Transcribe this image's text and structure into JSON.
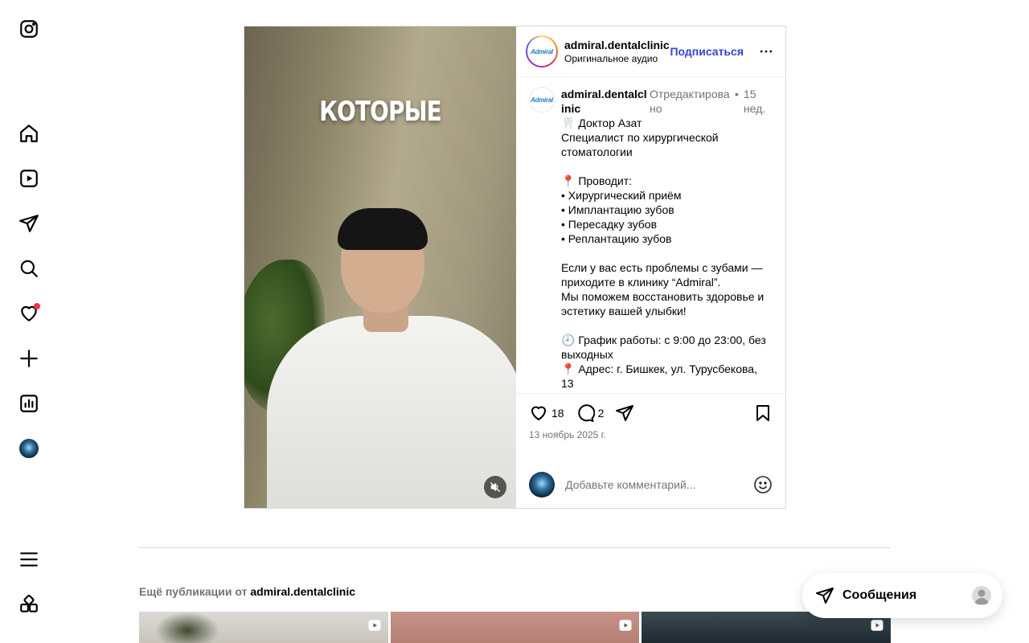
{
  "nav": {
    "items": [
      "instagram-logo",
      "home",
      "reels",
      "direct",
      "search",
      "notifications",
      "create",
      "insights",
      "profile",
      "more",
      "also-from-meta"
    ]
  },
  "post": {
    "media": {
      "overlay_text": "КОТОРЫЕ"
    },
    "header": {
      "username": "admiral.dentalclinic",
      "audio": "Оригинальное аудио",
      "follow_label": "Подписаться",
      "logo_text": "Admiral"
    },
    "caption": {
      "username": "admiral.dentalclinic",
      "edited": "Отредактировано",
      "dot": "•",
      "time": "15 нед.",
      "text": "🦷 Доктор Азат\nСпециалист по хирургической стоматологии\n\n📍 Проводит:\n• Хирургический приём\n• Имплантацию зубов\n• Пересадку зубов\n• Реплантацию зубов\n\nЕсли у вас есть проблемы с зубами — приходите в клинику “Admiral”.\nМы поможем восстановить здоровье и эстетику вашей улыбки!\n\n🕘 График работы: с 9:00 до 23:00, без выходных\n📍 Адрес: г. Бишкек, ул. Турусбекова, 13"
    },
    "actions": {
      "likes": "18",
      "comments": "2",
      "date": "13 ноябрь 2025 г."
    },
    "comment_box": {
      "placeholder": "Добавьте комментарий..."
    }
  },
  "more_posts": {
    "prefix": "Ещё публикации от",
    "account": "admiral.dentalclinic"
  },
  "messages": {
    "label": "Сообщения"
  },
  "colors": {
    "accent": "#3344d8",
    "notification": "#ff3040",
    "muted_text": "#737373",
    "border": "#dbdbdb"
  }
}
